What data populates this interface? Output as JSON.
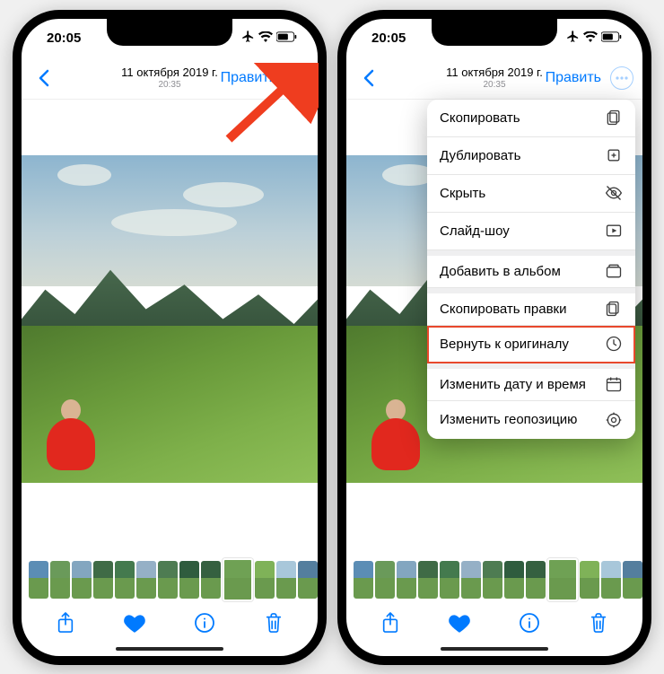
{
  "status": {
    "time": "20:05"
  },
  "nav": {
    "date": "11 октября 2019 г.",
    "time": "20:35",
    "edit": "Править"
  },
  "menu": {
    "copy": "Скопировать",
    "duplicate": "Дублировать",
    "hide": "Скрыть",
    "slideshow": "Слайд-шоу",
    "add_album": "Добавить в альбом",
    "copy_edits": "Скопировать правки",
    "revert": "Вернуть к оригиналу",
    "change_date": "Изменить дату и время",
    "change_location": "Изменить геопозицию"
  },
  "thumb_colors": [
    "#5b8db5",
    "#6a9a5a",
    "#83a6c0",
    "#3f6b46",
    "#447a4e",
    "#95b0c6",
    "#4e7c52",
    "#2f5c3e",
    "#356040",
    "#6fa154",
    "#7fb258",
    "#a8c7da",
    "#547e9e",
    "#3e6b48"
  ],
  "accent": "#007aff",
  "highlight": "#e8482c"
}
